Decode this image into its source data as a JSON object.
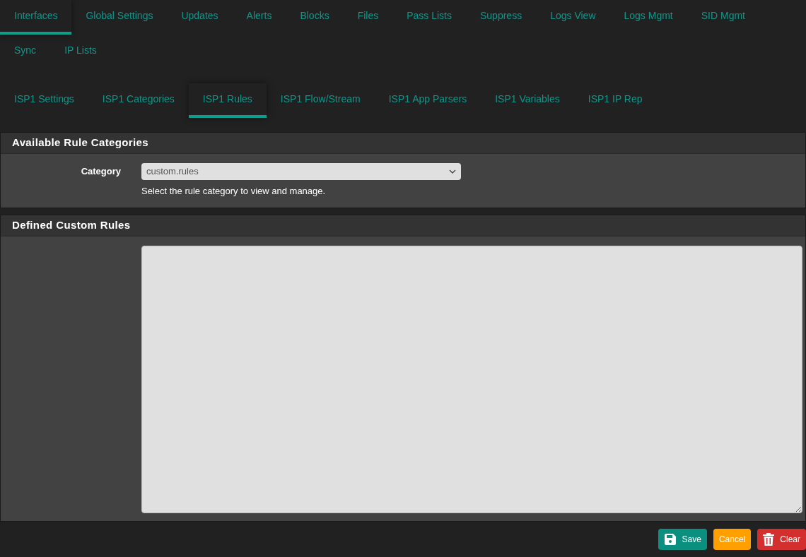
{
  "main_tabs": [
    {
      "label": "Interfaces",
      "selected": true
    },
    {
      "label": "Global Settings",
      "selected": false
    },
    {
      "label": "Updates",
      "selected": false
    },
    {
      "label": "Alerts",
      "selected": false
    },
    {
      "label": "Blocks",
      "selected": false
    },
    {
      "label": "Files",
      "selected": false
    },
    {
      "label": "Pass Lists",
      "selected": false
    },
    {
      "label": "Suppress",
      "selected": false
    },
    {
      "label": "Logs View",
      "selected": false
    },
    {
      "label": "Logs Mgmt",
      "selected": false
    },
    {
      "label": "SID Mgmt",
      "selected": false
    },
    {
      "label": "Sync",
      "selected": false
    },
    {
      "label": "IP Lists",
      "selected": false
    }
  ],
  "sub_tabs": [
    {
      "label": "ISP1 Settings",
      "selected": false
    },
    {
      "label": "ISP1 Categories",
      "selected": false
    },
    {
      "label": "ISP1 Rules",
      "selected": true
    },
    {
      "label": "ISP1 Flow/Stream",
      "selected": false
    },
    {
      "label": "ISP1 App Parsers",
      "selected": false
    },
    {
      "label": "ISP1 Variables",
      "selected": false
    },
    {
      "label": "ISP1 IP Rep",
      "selected": false
    }
  ],
  "categories_panel": {
    "title": "Available Rule Categories",
    "field_label": "Category",
    "value": "custom.rules",
    "help": "Select the rule category to view and manage."
  },
  "rules_panel": {
    "title": "Defined Custom Rules"
  },
  "buttons": [
    {
      "label": "Save",
      "kind": "save"
    },
    {
      "label": "Cancel",
      "kind": "cancel"
    },
    {
      "label": "Clear",
      "kind": "clear"
    }
  ]
}
